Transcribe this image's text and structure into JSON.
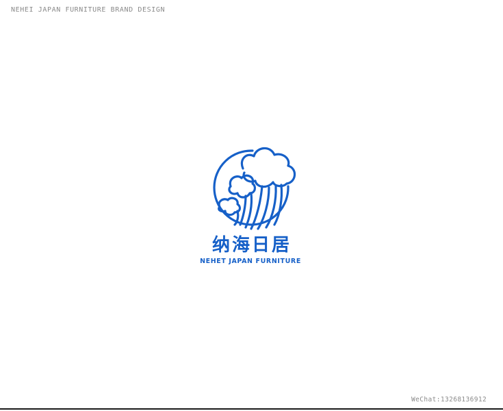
{
  "header": {
    "caption": "NEHEI JAPAN FURNITURE BRAND DESIGN"
  },
  "logo": {
    "icon": "wave-cloud-circle-icon",
    "name_cn": "纳海日居",
    "name_en": "NEHET JAPAN FURNITURE",
    "color": "#1660c8"
  },
  "footer": {
    "contact": "WeChat:13268136912"
  },
  "colors": {
    "background": "#ffffff",
    "caption": "#8a8a8a",
    "brand_blue": "#1660c8",
    "rule": "#1a1a1a"
  }
}
